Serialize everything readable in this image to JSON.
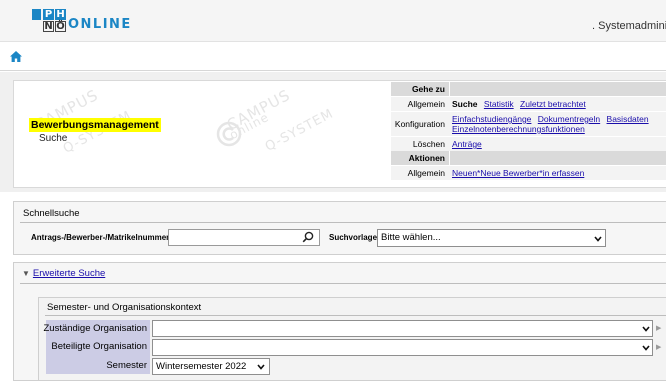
{
  "app": {
    "logo_letters": [
      "P",
      "H",
      "N",
      "Ö"
    ],
    "logo_word": "ONLINE",
    "user_role": ". Systemadminis",
    "colors": {
      "logo_blue": "#1b86c5",
      "highlight": "#ffff00",
      "link": "#1a0dab",
      "label_bg": "#cccce5"
    }
  },
  "nav": {
    "home_icon": "home-icon"
  },
  "header": {
    "title": "Bewerbungsmanagement",
    "subtitle": "Suche",
    "watermark_lines": [
      "CAMPUS",
      "online",
      "Q-SYSTEM"
    ]
  },
  "gehezu": {
    "title": "Gehe zu",
    "rows": [
      {
        "label": "Allgemein",
        "current": "Suche",
        "links": [
          "Statistik",
          "Zuletzt betrachtet"
        ]
      },
      {
        "label": "Konfiguration",
        "links": [
          "Einfachstudiengänge",
          "Dokumentregeln",
          "Basisdaten",
          "Einzelnotenberechnungsfunktionen"
        ]
      },
      {
        "label": "Löschen",
        "links": [
          "Anträge"
        ]
      }
    ],
    "actions_title": "Aktionen",
    "actions_rows": [
      {
        "label": "Allgemein",
        "links": [
          "Neuen*Neue Bewerber*in erfassen"
        ]
      }
    ]
  },
  "schnellsuche": {
    "title": "Schnellsuche",
    "search_label": "Antrags-/Bewerber-/Matrikelnummer",
    "search_value": "",
    "vorlage_label": "Suchvorlage",
    "vorlage_value": "Bitte wählen..."
  },
  "erweitert": {
    "toggle_label": "Erweiterte Suche",
    "toggle_symbol": "▼",
    "context_title": "Semester- und Organisationskontext",
    "fields": [
      {
        "label": "Zuständige Organisation",
        "value": ""
      },
      {
        "label": "Beteiligte Organisation",
        "value": ""
      },
      {
        "label": "Semester",
        "value": "Wintersemester 2022"
      }
    ]
  }
}
